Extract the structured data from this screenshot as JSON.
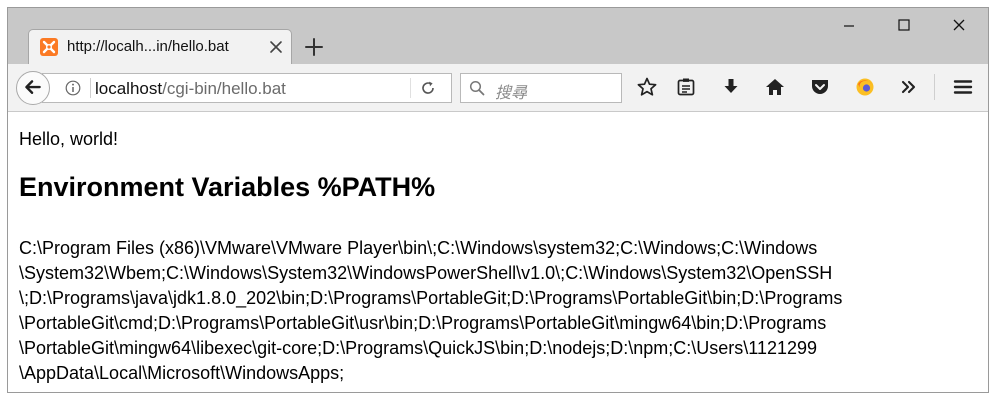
{
  "browser": {
    "tab": {
      "title": "http://localh...in/hello.bat",
      "favicon": "xampp-favicon-icon"
    },
    "window_controls": [
      "minimize-icon",
      "maximize-icon",
      "close-icon"
    ],
    "url": {
      "host": "localhost",
      "path": "/cgi-bin/hello.bat"
    },
    "search": {
      "placeholder": "搜尋"
    },
    "toolbar_icons": [
      "bookmark-star-icon",
      "reading-list-icon",
      "download-icon",
      "home-icon",
      "pocket-icon",
      "extension-icon",
      "overflow-chevron-icon",
      "hamburger-menu-icon"
    ],
    "colors": {
      "titlebar": "#c8c8c8",
      "toolbar": "#f2f2f2",
      "favicon": "#fb7a24"
    }
  },
  "page": {
    "greeting": "Hello, world!",
    "heading": "Environment Variables %PATH%",
    "path_lines": [
      "C:\\Program Files (x86)\\VMware\\VMware Player\\bin\\;C:\\Windows\\system32;C:\\Windows;C:\\Windows",
      "\\System32\\Wbem;C:\\Windows\\System32\\WindowsPowerShell\\v1.0\\;C:\\Windows\\System32\\OpenSSH",
      "\\;D:\\Programs\\java\\jdk1.8.0_202\\bin;D:\\Programs\\PortableGit;D:\\Programs\\PortableGit\\bin;D:\\Programs",
      "\\PortableGit\\cmd;D:\\Programs\\PortableGit\\usr\\bin;D:\\Programs\\PortableGit\\mingw64\\bin;D:\\Programs",
      "\\PortableGit\\mingw64\\libexec\\git-core;D:\\Programs\\QuickJS\\bin;D:\\nodejs;D:\\npm;C:\\Users\\1121299",
      "\\AppData\\Local\\Microsoft\\WindowsApps;"
    ]
  }
}
